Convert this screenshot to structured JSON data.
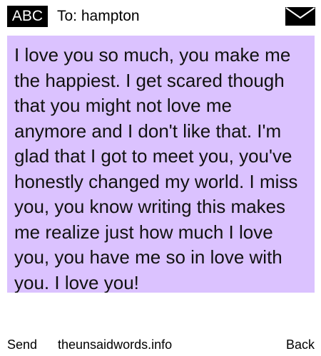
{
  "header": {
    "badge": "ABC",
    "recipient": "To: hampton",
    "icon": "envelope-icon"
  },
  "message": {
    "text": "I love you so much, you make me the happiest. I get scared though that you might not love me anymore and I don't like that. I'm glad that I got to meet you, you've honestly changed my world. I miss you, you know writing this makes me realize just how much I love you, you have me so in love with you. I love you!",
    "background": "#dbc2ff"
  },
  "footer": {
    "send_label": "Send",
    "site": "theunsaidwords.info",
    "back_label": "Back"
  }
}
